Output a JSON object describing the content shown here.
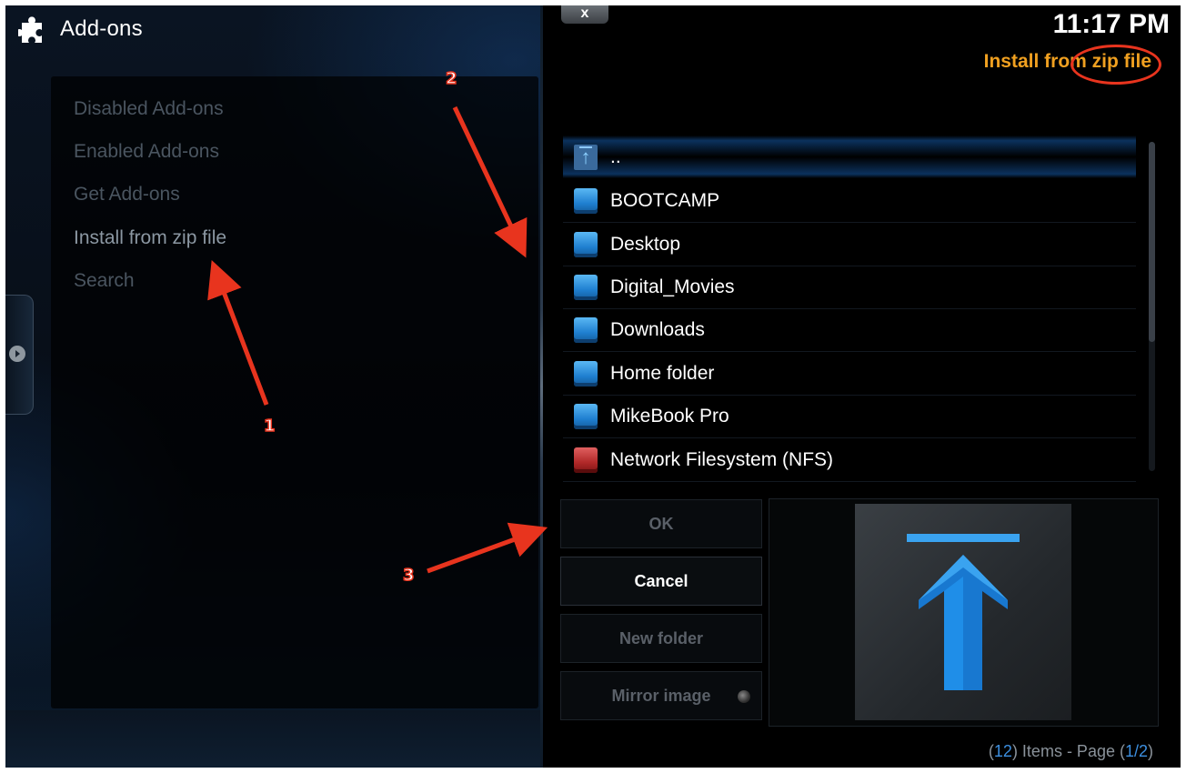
{
  "header": {
    "title": "Add-ons",
    "icon": "puzzle-icon"
  },
  "menu": {
    "items": [
      {
        "label": "Disabled Add-ons"
      },
      {
        "label": "Enabled Add-ons"
      },
      {
        "label": "Get Add-ons"
      },
      {
        "label": "Install from zip file"
      },
      {
        "label": "Search"
      }
    ]
  },
  "dialog": {
    "close_label": "x",
    "clock": "11:17 PM",
    "title": "Install from zip file",
    "files": [
      {
        "name": "..",
        "icon": "up-folder-icon"
      },
      {
        "name": "BOOTCAMP",
        "icon": "drive-icon"
      },
      {
        "name": "Desktop",
        "icon": "drive-icon"
      },
      {
        "name": "Digital_Movies",
        "icon": "drive-icon"
      },
      {
        "name": "Downloads",
        "icon": "drive-icon"
      },
      {
        "name": "Home folder",
        "icon": "drive-icon"
      },
      {
        "name": "MikeBook Pro",
        "icon": "drive-icon"
      },
      {
        "name": "Network Filesystem (NFS)",
        "icon": "nfs-icon"
      }
    ],
    "buttons": {
      "ok": "OK",
      "cancel": "Cancel",
      "new_folder": "New folder",
      "mirror_image": "Mirror image"
    },
    "footer": {
      "open_paren": "(",
      "count": "12",
      "middle": ") Items - Page (",
      "page": "1/2",
      "close_paren": ")"
    }
  },
  "annotations": {
    "labels": [
      "1",
      "2",
      "3"
    ],
    "color": "#e8341e"
  },
  "colors": {
    "title_accent": "#f0a020",
    "highlight_blue": "#3c8fe0"
  }
}
